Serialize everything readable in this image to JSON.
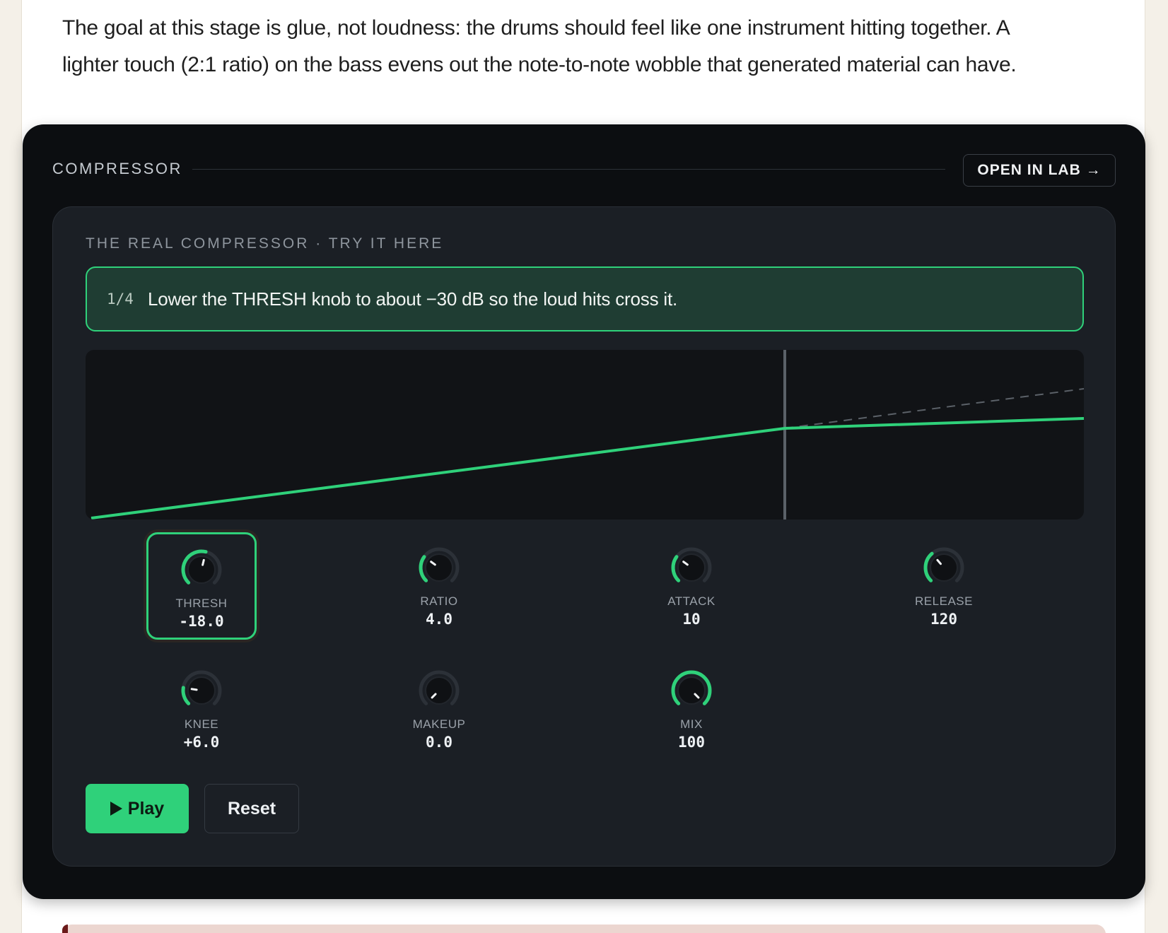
{
  "intro": {
    "line1": "The goal at this stage is glue, not loudness: the drums should feel like one instrument hitting together. A",
    "line2": "lighter touch (2:1 ratio) on the bass evens out the note-to-note wobble that generated material can have."
  },
  "widget": {
    "title": "COMPRESSOR",
    "open_lab_label": "OPEN IN LAB →",
    "inner_title": "THE REAL COMPRESSOR · TRY IT HERE",
    "step": {
      "counter": "1/4",
      "text": "Lower the THRESH knob to about −30 dB so the loud hits cross it."
    },
    "knobs": [
      {
        "label": "THRESH",
        "value": "-18.0",
        "level": 0.55,
        "active": true
      },
      {
        "label": "RATIO",
        "value": "4.0",
        "level": 0.3,
        "active": false
      },
      {
        "label": "ATTACK",
        "value": "10",
        "level": 0.3,
        "active": false
      },
      {
        "label": "RELEASE",
        "value": "120",
        "level": 0.35,
        "active": false
      },
      {
        "label": "KNEE",
        "value": "+6.0",
        "level": 0.2,
        "active": false
      },
      {
        "label": "MAKEUP",
        "value": "0.0",
        "level": 0.0,
        "active": false
      },
      {
        "label": "MIX",
        "value": "100",
        "level": 1.0,
        "active": false
      }
    ],
    "play_label": "Play",
    "reset_label": "Reset"
  },
  "colors": {
    "accent": "#2fd17a",
    "panel": "#1b1f25",
    "background": "#0c0e11"
  }
}
